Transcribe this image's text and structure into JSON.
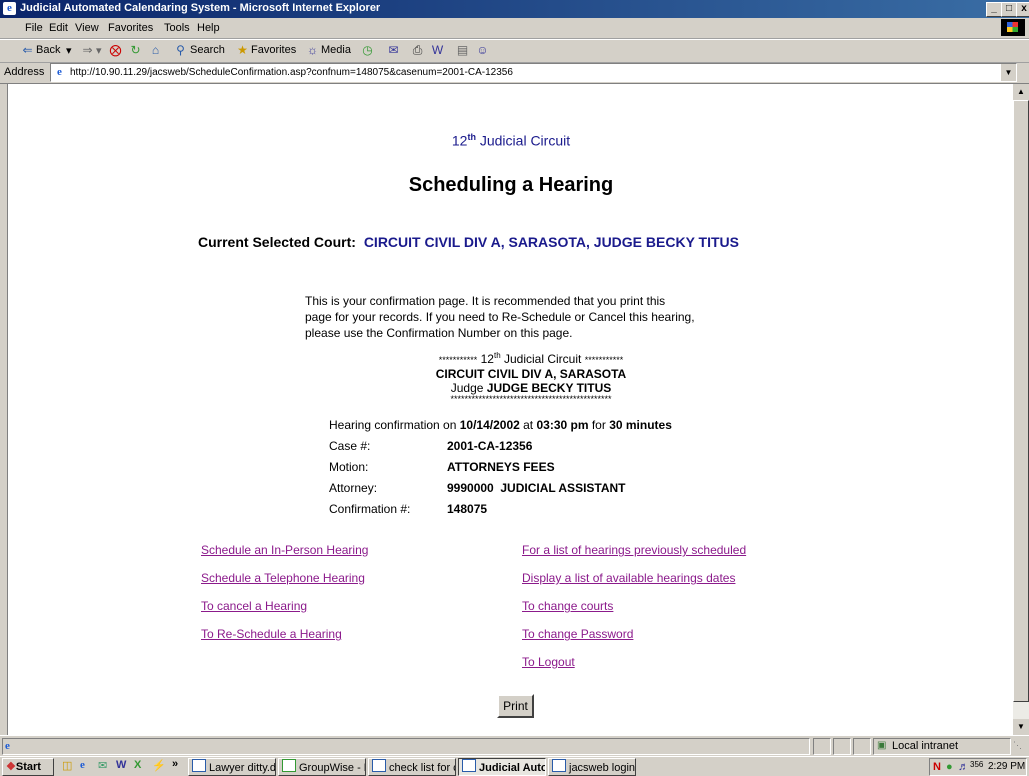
{
  "window": {
    "title": "Judicial Automated Calendaring System - Microsoft Internet Explorer",
    "controls": [
      "_",
      "□",
      "x"
    ]
  },
  "menu": [
    "File",
    "Edit",
    "View",
    "Favorites",
    "Tools",
    "Help"
  ],
  "toolbar": {
    "back": "Back",
    "search": "Search",
    "favorites": "Favorites",
    "media": "Media"
  },
  "address": {
    "label": "Address",
    "url": "http://10.90.11.29/jacsweb/ScheduleConfirmation.asp?confnum=148075&casenum=2001-CA-12356"
  },
  "page": {
    "circuit_num": "12",
    "circuit_sup": "th",
    "circuit_rest": " Judicial Circuit",
    "heading": "Scheduling a Hearing",
    "court_label": "Current Selected Court:",
    "court_value": "CIRCUIT CIVIL DIV A, SARASOTA, JUDGE BECKY TITUS",
    "intro_lines": [
      "This is your confirmation page. It is recommended that you print this",
      "page for your records. If you need to Re-Schedule or Cancel this hearing,",
      "please use the Confirmation Number on this page."
    ],
    "banner": {
      "stars_left": "***********",
      "circuit_num": " 12",
      "circuit_sup": "th",
      "circuit_rest": " Judicial Circuit ",
      "stars_right": "***********",
      "division": "CIRCUIT CIVIL DIV A, SARASOTA",
      "judge_label": "Judge ",
      "judge_name": "JUDGE BECKY TITUS",
      "stars_line": "**********************************************"
    },
    "confirmation": {
      "prefix": "Hearing confirmation on ",
      "date": "10/14/2002",
      "at": " at ",
      "time": "03:30 pm",
      "for": " for ",
      "duration": "30 minutes",
      "rows": [
        {
          "label": "Case #:",
          "value": "2001-CA-12356"
        },
        {
          "label": "Motion:",
          "value": "ATTORNEYS FEES"
        },
        {
          "label": "Attorney:",
          "value": "9990000  JUDICIAL ASSISTANT"
        },
        {
          "label": "Confirmation #:",
          "value": "148075"
        }
      ]
    },
    "links_left": [
      "Schedule an In-Person Hearing",
      "Schedule a Telephone Hearing",
      "To cancel a Hearing",
      "To Re-Schedule a Hearing"
    ],
    "links_right": [
      "For a list of hearings previously scheduled",
      "Display a list of available hearings dates",
      "To change courts",
      "To change Password",
      "To Logout"
    ],
    "print_label": "Print"
  },
  "status": {
    "zone": "Local intranet"
  },
  "taskbar": {
    "start": "Start",
    "tasks": [
      "Lawyer ditty.d...",
      "GroupWise - M...",
      "check list for c...",
      "Judicial Auto...",
      "jacsweb login...."
    ],
    "clock": "2:29 PM",
    "tray_count": "356"
  }
}
